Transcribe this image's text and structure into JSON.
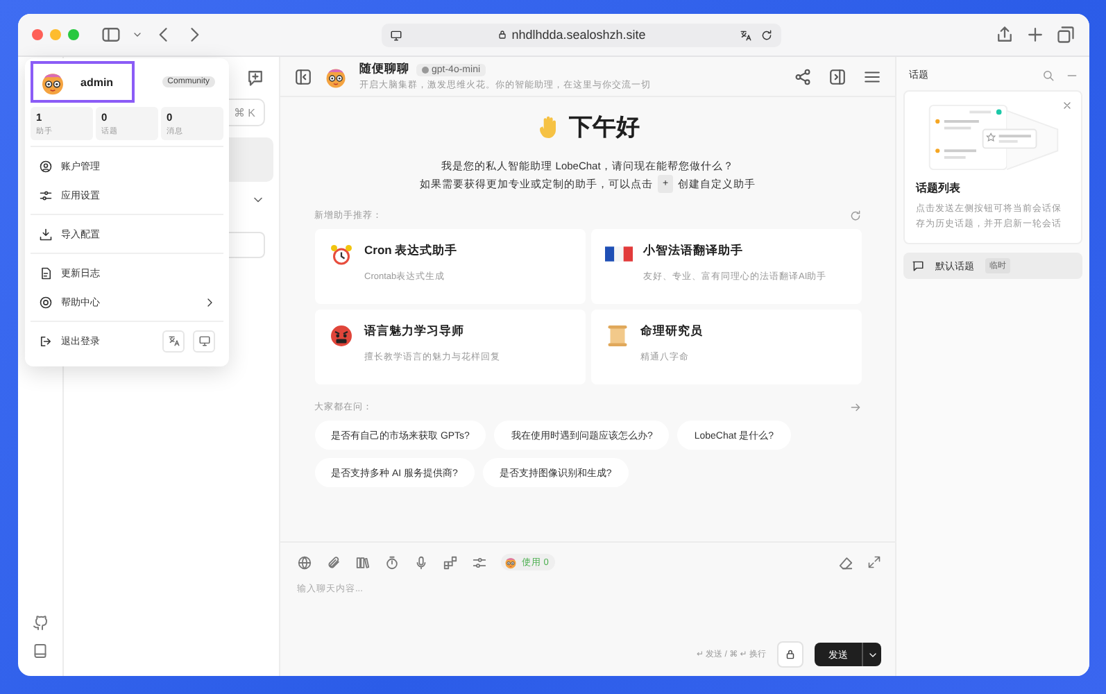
{
  "browser": {
    "address": "nhdlhdda.sealoshzh.site"
  },
  "user_menu": {
    "username": "admin",
    "badge": "Community",
    "stats": [
      {
        "value": "1",
        "label": "助手"
      },
      {
        "value": "0",
        "label": "话题"
      },
      {
        "value": "0",
        "label": "消息"
      }
    ],
    "groups": [
      [
        {
          "label": "账户管理",
          "has_submenu": false
        },
        {
          "label": "应用设置",
          "has_submenu": false
        }
      ],
      [
        {
          "label": "导入配置",
          "has_submenu": false
        }
      ],
      [
        {
          "label": "更新日志",
          "has_submenu": false
        },
        {
          "label": "帮助中心",
          "has_submenu": true
        }
      ]
    ],
    "logout": "退出登录"
  },
  "session_panel": {
    "search_shortcut": "⌘ K"
  },
  "chat_header": {
    "title": "随便聊聊",
    "model": "gpt-4o-mini",
    "description": "开启大脑集群，激发思维火花。你的智能助理，在这里与你交流一切"
  },
  "welcome": {
    "greeting": "下午好",
    "line_1": "我是您的私人智能助理 LobeChat，请问现在能帮您做什么？",
    "line_2_before": "如果需要获得更加专业或定制的助手，可以点击",
    "line_2_key": "+",
    "line_2_after": "创建自定义助手"
  },
  "recommend": {
    "title": "新增助手推荐：",
    "cards": [
      {
        "title": "Cron 表达式助手",
        "description": "Crontab表达式生成"
      },
      {
        "title": "小智法语翻译助手",
        "description": "友好、专业、富有同理心的法语翻译AI助手"
      },
      {
        "title": "语言魅力学习导师",
        "description": "擅长教学语言的魅力与花样回复"
      },
      {
        "title": "命理研究员",
        "description": "精通八字命"
      }
    ]
  },
  "questions": {
    "title": "大家都在问：",
    "items": [
      "是否有自己的市场来获取 GPTs?",
      "我在使用时遇到问题应该怎么办?",
      "LobeChat 是什么?",
      "是否支持多种 AI 服务提供商?",
      "是否支持图像识别和生成?"
    ]
  },
  "input": {
    "token_usage": "使用 0",
    "placeholder": "输入聊天内容...",
    "hint": "↵ 发送 / ⌘ ↵ 换行",
    "send": "发送"
  },
  "topics": {
    "title": "话题",
    "guide_title": "话题列表",
    "guide_text": "点击发送左侧按钮可将当前会话保存为历史话题，并开启新一轮会话",
    "items": [
      {
        "label": "默认话题",
        "tag": "临时",
        "selected": true
      }
    ]
  }
}
